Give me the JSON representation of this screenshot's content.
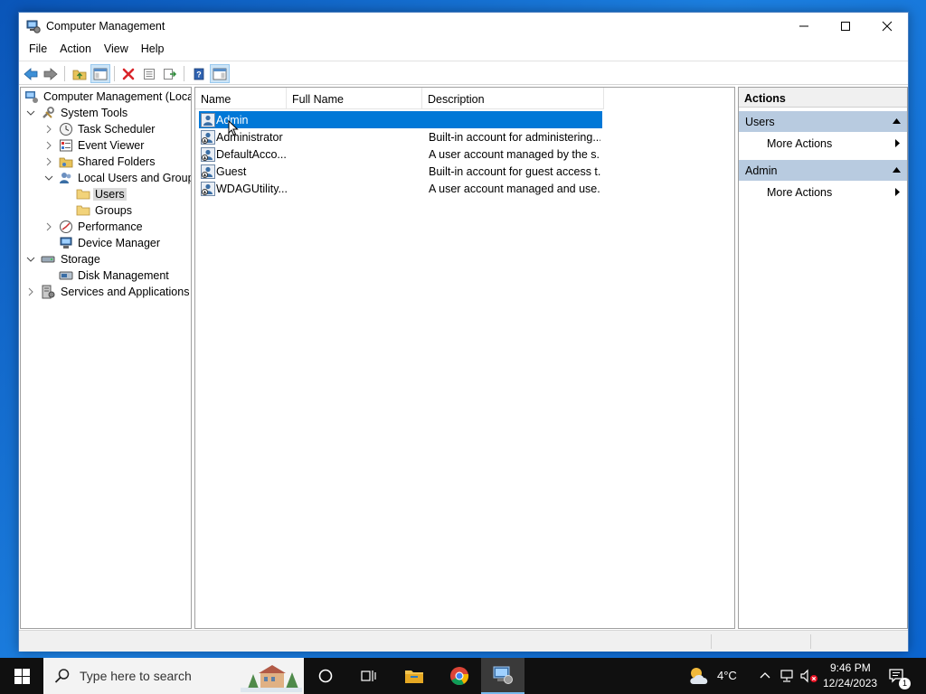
{
  "window": {
    "title": "Computer Management",
    "controls": {
      "minimize": "minimize",
      "maximize": "maximize",
      "close": "close"
    }
  },
  "menu": [
    "File",
    "Action",
    "View",
    "Help"
  ],
  "tree": {
    "root": "Computer Management (Local",
    "system_tools": "System Tools",
    "task_scheduler": "Task Scheduler",
    "event_viewer": "Event Viewer",
    "shared_folders": "Shared Folders",
    "local_users_groups": "Local Users and Groups",
    "users": "Users",
    "groups": "Groups",
    "performance": "Performance",
    "device_manager": "Device Manager",
    "storage": "Storage",
    "disk_management": "Disk Management",
    "services_apps": "Services and Applications"
  },
  "list": {
    "columns": {
      "name": "Name",
      "full_name": "Full Name",
      "description": "Description"
    },
    "rows": [
      {
        "name": "Admin",
        "full_name": "",
        "description": ""
      },
      {
        "name": "Administrator",
        "full_name": "",
        "description": "Built-in account for administering..."
      },
      {
        "name": "DefaultAcco...",
        "full_name": "",
        "description": "A user account managed by the s..."
      },
      {
        "name": "Guest",
        "full_name": "",
        "description": "Built-in account for guest access t..."
      },
      {
        "name": "WDAGUtility...",
        "full_name": "",
        "description": "A user account managed and use..."
      }
    ],
    "selected_row": 0
  },
  "actions": {
    "title": "Actions",
    "sections": [
      {
        "header": "Users",
        "item": "More Actions"
      },
      {
        "header": "Admin",
        "item": "More Actions"
      }
    ]
  },
  "taskbar": {
    "search_placeholder": "Type here to search",
    "weather": "4°C",
    "time": "9:46 PM",
    "date": "12/24/2023",
    "notification_count": "1"
  },
  "colors": {
    "selection": "#0078d7",
    "section_header": "#b8cbe0",
    "taskbar": "#101010"
  }
}
